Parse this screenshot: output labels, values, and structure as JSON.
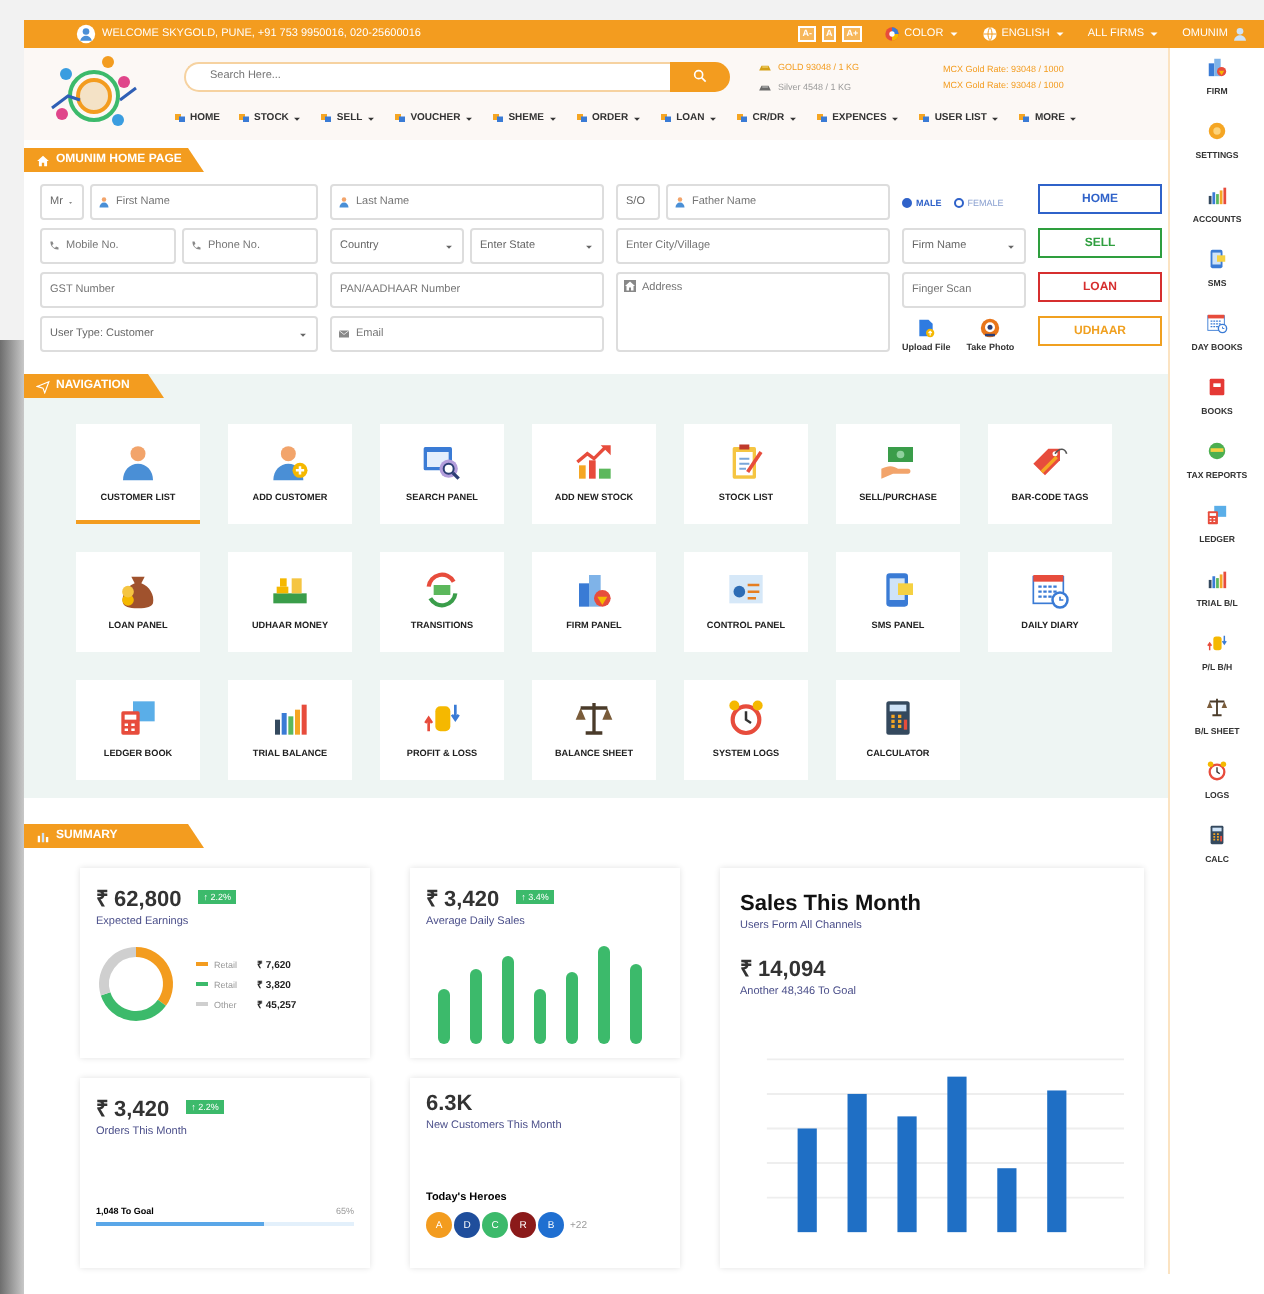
{
  "top_bar": {
    "welcome": "WELCOME SKYGOLD, PUNE, +91 753 9950016, 020-25600016",
    "font_buttons": [
      "A-",
      "A",
      "A+"
    ],
    "menus": [
      "COLOR",
      "ENGLISH",
      "ALL FIRMS",
      "OMUNIM"
    ]
  },
  "header": {
    "search": {
      "placeholder": "Search Here..."
    },
    "rates": [
      "GOLD 93048 / 1 KG",
      "Silver 4548 / 1 KG"
    ],
    "mcx_rates": [
      "MCX Gold Rate: 93048 / 1000",
      "MCX Gold Rate: 93048 / 1000"
    ],
    "menu": [
      {
        "label": "HOME",
        "dropdown": false
      },
      {
        "label": "STOCK",
        "dropdown": true
      },
      {
        "label": "SELL",
        "dropdown": true
      },
      {
        "label": "VOUCHER",
        "dropdown": true
      },
      {
        "label": "SHEME",
        "dropdown": true
      },
      {
        "label": "ORDER",
        "dropdown": true
      },
      {
        "label": "LOAN",
        "dropdown": true
      },
      {
        "label": "CR/DR",
        "dropdown": true
      },
      {
        "label": "EXPENCES",
        "dropdown": true
      },
      {
        "label": "USER LIST",
        "dropdown": true
      },
      {
        "label": "MORE",
        "dropdown": true
      }
    ]
  },
  "sidebar": {
    "items": [
      "FIRM",
      "SETTINGS",
      "ACCOUNTS",
      "SMS",
      "DAY BOOKS",
      "BOOKS",
      "TAX REPORTS",
      "LEDGER",
      "TRIAL B/L",
      "P/L B/H",
      "B/L SHEET",
      "LOGS",
      "CALC"
    ]
  },
  "form": {
    "title": "OMUNIM HOME PAGE",
    "prefix": "Mr",
    "first_name": {
      "placeholder": "First Name"
    },
    "last_name": {
      "placeholder": "Last Name"
    },
    "relation": "S/O",
    "father_name": {
      "placeholder": "Father Name"
    },
    "gender": [
      {
        "label": "MALE",
        "selected": true
      },
      {
        "label": "FEMALE",
        "selected": false
      }
    ],
    "mobile": {
      "placeholder": "Mobile No."
    },
    "phone": {
      "placeholder": "Phone No."
    },
    "country": "Country",
    "state": "Enter State",
    "city": {
      "placeholder": "Enter City/Village"
    },
    "firm": "Firm Name",
    "gst": {
      "placeholder": "GST Number"
    },
    "pan": {
      "placeholder": "PAN/AADHAAR Number"
    },
    "address": {
      "placeholder": "Address"
    },
    "finger": {
      "placeholder": "Finger Scan"
    },
    "user_type": "User Type: Customer",
    "email": {
      "placeholder": "Email"
    },
    "uploads": [
      "Upload File",
      "Take Photo"
    ],
    "buttons": [
      {
        "label": "HOME",
        "color": "#2f62c9"
      },
      {
        "label": "SELL",
        "color": "#2e9e3e"
      },
      {
        "label": "LOAN",
        "color": "#d62f2f"
      },
      {
        "label": "UDHAAR",
        "color": "#f0a020"
      }
    ]
  },
  "navigation": {
    "title": "NAVIGATION",
    "items": [
      {
        "label": "CUSTOMER LIST",
        "selected": true
      },
      {
        "label": "ADD CUSTOMER",
        "selected": false
      },
      {
        "label": "SEARCH PANEL",
        "selected": false
      },
      {
        "label": "ADD NEW STOCK",
        "selected": false
      },
      {
        "label": "STOCK LIST",
        "selected": false
      },
      {
        "label": "SELL/PURCHASE",
        "selected": false
      },
      {
        "label": "BAR-CODE TAGS",
        "selected": false
      },
      {
        "label": "LOAN PANEL",
        "selected": false
      },
      {
        "label": "UDHAAR MONEY",
        "selected": false
      },
      {
        "label": "TRANSITIONS",
        "selected": false
      },
      {
        "label": "FIRM PANEL",
        "selected": false
      },
      {
        "label": "CONTROL PANEL",
        "selected": false
      },
      {
        "label": "SMS PANEL",
        "selected": false
      },
      {
        "label": "DAILY DIARY",
        "selected": false
      },
      {
        "label": "LEDGER BOOK",
        "selected": false
      },
      {
        "label": "TRIAL BALANCE",
        "selected": false
      },
      {
        "label": "PROFIT & LOSS",
        "selected": false
      },
      {
        "label": "BALANCE SHEET",
        "selected": false
      },
      {
        "label": "SYSTEM LOGS",
        "selected": false
      },
      {
        "label": "CALCULATOR",
        "selected": false
      }
    ]
  },
  "summary": {
    "title": "SUMMARY",
    "earnings": {
      "amount": "₹ 62,800",
      "change": "↑ 2.2%",
      "label": "Expected Earnings",
      "legend": [
        {
          "label": "Retail",
          "value": "₹ 7,620",
          "color": "#f39c1f"
        },
        {
          "label": "Retail",
          "value": "₹ 3,820",
          "color": "#3cba6b"
        },
        {
          "label": "Other",
          "value": "₹ 45,257",
          "color": "#cfcfcf"
        }
      ]
    },
    "daily": {
      "amount": "₹ 3,420",
      "change": "↑ 3.4%",
      "label": "Average Daily Sales"
    },
    "orders": {
      "amount": "₹ 3,420",
      "change": "↑ 2.2%",
      "label": "Orders This Month",
      "goal": "1,048 To Goal",
      "percent": "65%",
      "level": 0.65
    },
    "customers": {
      "amount": "6.3K",
      "label": "New Customers This Month",
      "heroes_title": "Today's Heroes",
      "heroes": [
        {
          "initial": "A",
          "color": "#f39c1f"
        },
        {
          "initial": "D",
          "color": "#1f4e9c"
        },
        {
          "initial": "C",
          "color": "#3cba6b"
        },
        {
          "initial": "R",
          "color": "#8b1a1a"
        },
        {
          "initial": "B",
          "color": "#1f6fd1"
        }
      ],
      "more": "+22"
    },
    "sales": {
      "title": "Sales This Month",
      "subtitle": "Users Form All Channels",
      "amount": "₹ 14,094",
      "goal": "Another 48,346 To Goal"
    }
  }
}
